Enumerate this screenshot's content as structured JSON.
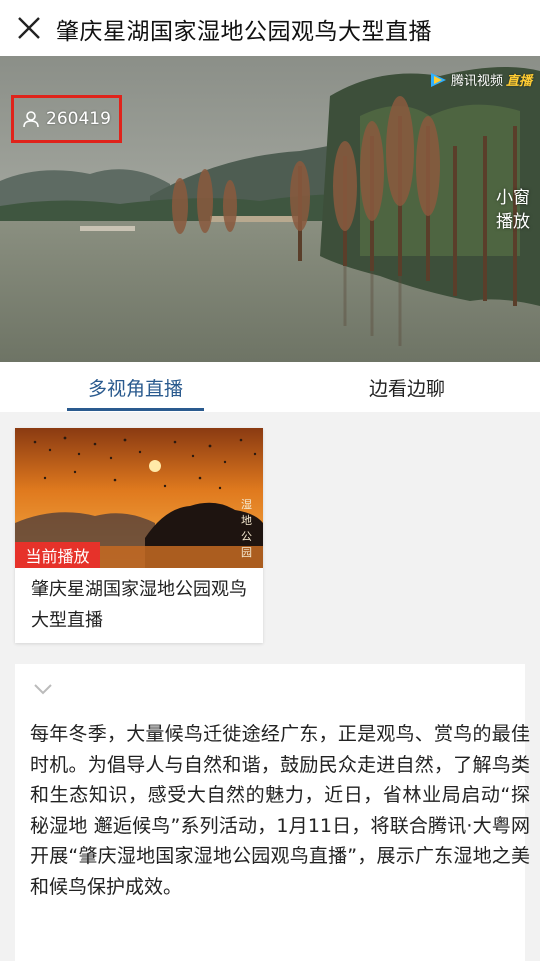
{
  "header": {
    "title": "肇庆星湖国家湿地公园观鸟大型直播"
  },
  "video": {
    "viewer_count": "260419",
    "brand_text": "腾讯视频",
    "live_tag": "直播",
    "mini_window_line1": "小窗",
    "mini_window_line2": "播放"
  },
  "tabs": [
    {
      "label": "多视角直播",
      "active": true
    },
    {
      "label": "边看边聊",
      "active": false
    }
  ],
  "stream_card": {
    "badge": "当前播放",
    "title": "肇庆星湖国家湿地公园观鸟大型直播",
    "thumb_caption": [
      "湿",
      "地",
      "公",
      "园"
    ]
  },
  "description": {
    "text": "每年冬季，大量候鸟迁徙途经广东，正是观鸟、赏鸟的最佳时机。为倡导人与自然和谐，鼓励民众走进自然，了解鸟类和生态知识，感受大自然的魅力，近日，省林业局启动“探秘湿地 邂逅候鸟”系列活动，1月11日，将联合腾讯·大粤网开展“肇庆湿地国家湿地公园观鸟直播”，展示广东湿地之美和候鸟保护成效。"
  },
  "colors": {
    "accent": "#2a5a8e",
    "badge_red": "#e6322a",
    "highlight_box": "#e0231b"
  }
}
